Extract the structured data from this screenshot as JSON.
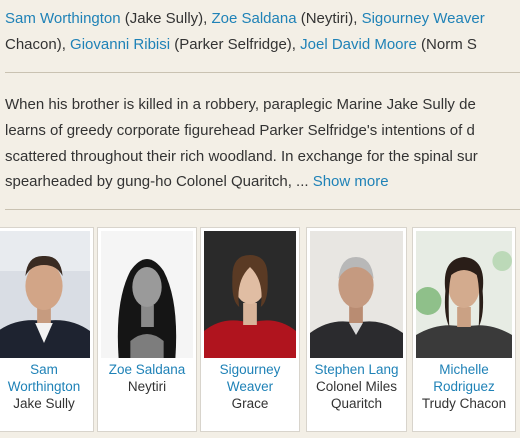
{
  "cast_line_1": [
    {
      "actor": "Sam Worthington",
      "role": " (Jake Sully), "
    },
    {
      "actor": "Zoe Saldana",
      "role": " (Neytiri), "
    },
    {
      "actor": "Sigourney Weaver",
      "role": ""
    }
  ],
  "cast_line_2": [
    {
      "prefix": "Chacon), ",
      "actor": "Giovanni Ribisi",
      "role": " (Parker Selfridge), "
    },
    {
      "actor": "Joel David Moore",
      "role": " (Norm S"
    }
  ],
  "synopsis": {
    "line1": "When his brother is killed in a robbery, paraplegic Marine Jake Sully de",
    "line2": "learns of greedy corporate figurehead Parker Selfridge's intentions of d",
    "line3": "scattered throughout their rich woodland. In exchange for the spinal sur",
    "line4": "spearheaded by gung-ho Colonel Quaritch, ... ",
    "show_more": "Show more"
  },
  "cast_cards": [
    {
      "name_lines": [
        "Sam",
        "Worthington"
      ],
      "role_lines": [
        "Jake Sully"
      ],
      "photo_icon": "actor-photo"
    },
    {
      "name_lines": [
        "Zoe Saldana"
      ],
      "role_lines": [
        "Neytiri"
      ],
      "photo_icon": "actor-photo"
    },
    {
      "name_lines": [
        "Sigourney",
        "Weaver"
      ],
      "role_lines": [
        "Grace"
      ],
      "photo_icon": "actor-photo"
    },
    {
      "name_lines": [
        "Stephen Lang"
      ],
      "role_lines": [
        "Colonel Miles",
        "Quaritch"
      ],
      "photo_icon": "actor-photo"
    },
    {
      "name_lines": [
        "Michelle",
        "Rodriguez"
      ],
      "role_lines": [
        "Trudy Chacon"
      ],
      "photo_icon": "actor-photo"
    }
  ],
  "colors": {
    "link": "#1f82b7",
    "background": "#f3efe6",
    "text": "#333333"
  }
}
